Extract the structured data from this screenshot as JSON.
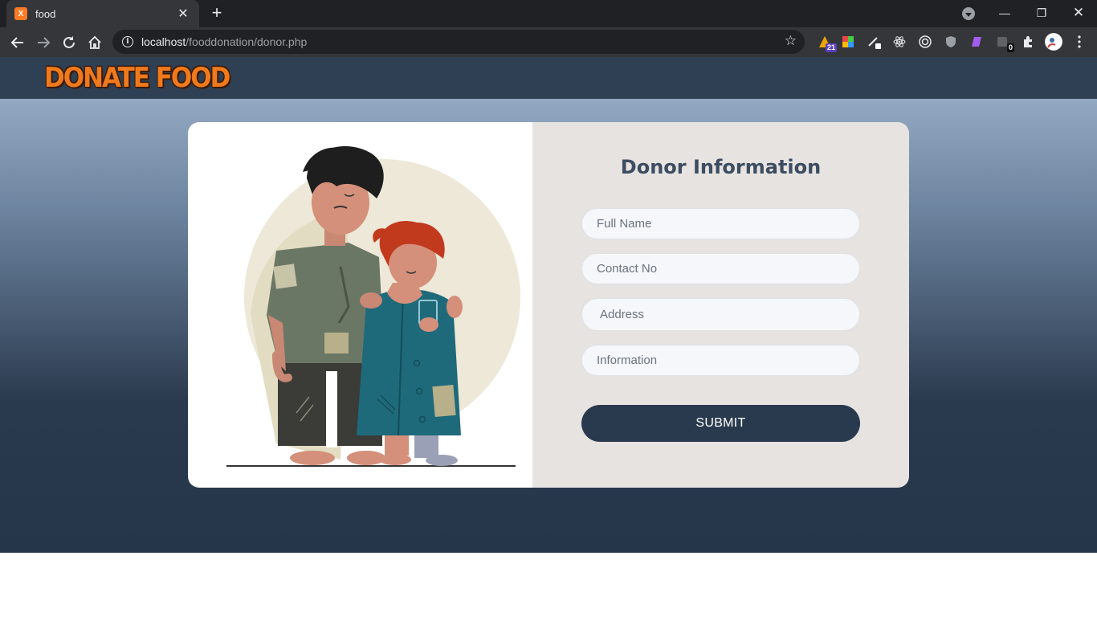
{
  "browser": {
    "tab_title": "food",
    "tab_favicon_text": "X",
    "new_tab_symbol": "+",
    "close_symbol": "✕",
    "url_host": "localhost",
    "url_path": "/fooddonation/donor.php",
    "extensions": [
      {
        "name": "ext-badge-21",
        "badge": "21"
      },
      {
        "name": "ext-badge-0",
        "badge": "0"
      }
    ]
  },
  "site": {
    "logo_text": "DONATE FOOD"
  },
  "form": {
    "title": "Donor Information",
    "full_name_placeholder": "Full Name",
    "contact_placeholder": "Contact No",
    "address_placeholder": "Address",
    "information_placeholder": "Information",
    "submit_label": "SUBMIT"
  },
  "colors": {
    "header": "#2f4054",
    "accent": "#ef7a1d",
    "button": "#2a3a4e",
    "form_panel": "#e6e3e1"
  }
}
